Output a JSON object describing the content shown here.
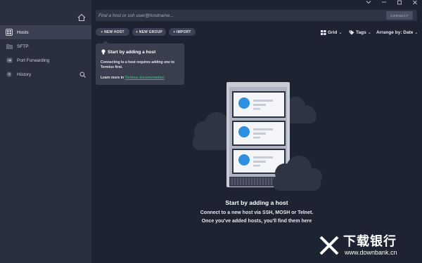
{
  "sidebar": {
    "items": [
      {
        "label": "Hosts",
        "icon": "hosts-icon",
        "active": true
      },
      {
        "label": "SFTP",
        "icon": "folder-icon",
        "active": false
      },
      {
        "label": "Port Forwarding",
        "icon": "port-forwarding-icon",
        "active": false
      },
      {
        "label": "History",
        "icon": "history-icon",
        "active": false
      }
    ]
  },
  "window_controls": [
    "chevron-down-icon",
    "minimize-icon",
    "maximize-icon",
    "close-icon"
  ],
  "search": {
    "placeholder": "Find a host or ssh user@hostname...",
    "connect_label": "CONNECT"
  },
  "toolbar": {
    "new_host": "+ NEW HOST",
    "new_group": "+ NEW GROUP",
    "import": "+ IMPORT",
    "grid": "Grid",
    "tags": "Tags",
    "arrange": "Arrange by: Date"
  },
  "tooltip": {
    "title": "Start by adding a host",
    "body": "Connecting to a host requires adding one to Termius first.",
    "learn_prefix": "Learn more in ",
    "learn_link": "Termius documentation"
  },
  "empty_state": {
    "title": "Start by adding a host",
    "line1": "Connect to a new host via SSH, MOSH or Telnet.",
    "line2": "Once you've added hosts, you'll find them here"
  },
  "watermark": {
    "cn": "下载银行",
    "en": "www.downbank.cn"
  },
  "colors": {
    "background": "#1e2331",
    "sidebar": "#2a2f3d",
    "accent_link": "#22b37a",
    "host_dot": "#2f8fe0"
  }
}
